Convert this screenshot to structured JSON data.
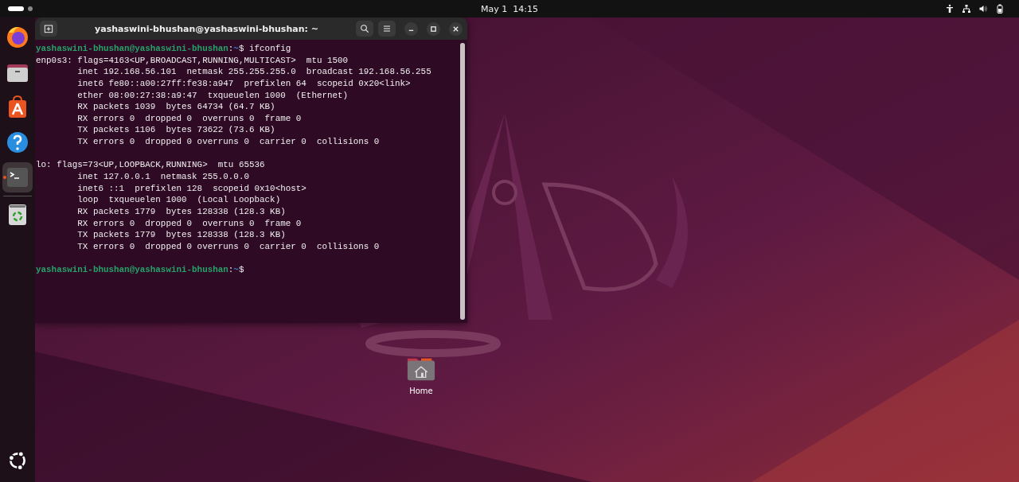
{
  "top_bar": {
    "workspaces": [
      {
        "selected": true
      },
      {
        "selected": false
      }
    ],
    "clock": "May 1  14:15",
    "status_icons": [
      {
        "kind": "accessibility"
      },
      {
        "kind": "network"
      },
      {
        "kind": "volume"
      },
      {
        "kind": "battery"
      }
    ]
  },
  "dock": {
    "items": [
      {
        "kind": "browser",
        "running": false,
        "selected": false
      },
      {
        "kind": "files",
        "running": false,
        "selected": false
      },
      {
        "kind": "store",
        "running": false,
        "selected": false
      },
      {
        "kind": "help",
        "running": false,
        "selected": false
      },
      {
        "kind": "terminal",
        "running": true,
        "selected": true
      },
      {
        "kind": "trash",
        "running": false,
        "selected": false
      }
    ],
    "apps_button": {
      "kind": "ubuntu"
    }
  },
  "terminal": {
    "title": "yashaswini-bhushan@yashaswini-bhushan: ~",
    "lines": [
      {
        "kind": "prompt",
        "user": "yashaswini-bhushan@yashaswini-bhushan",
        "sep": ":",
        "path": "~",
        "symbol": "$",
        "command": "ifconfig"
      },
      {
        "kind": "output",
        "text": "enp0s3: flags=4163<UP,BROADCAST,RUNNING,MULTICAST>  mtu 1500"
      },
      {
        "kind": "output",
        "text": "        inet 192.168.56.101  netmask 255.255.255.0  broadcast 192.168.56.255"
      },
      {
        "kind": "output",
        "text": "        inet6 fe80::a00:27ff:fe38:a947  prefixlen 64  scopeid 0x20<link>"
      },
      {
        "kind": "output",
        "text": "        ether 08:00:27:38:a9:47  txqueuelen 1000  (Ethernet)"
      },
      {
        "kind": "output",
        "text": "        RX packets 1039  bytes 64734 (64.7 KB)"
      },
      {
        "kind": "output",
        "text": "        RX errors 0  dropped 0  overruns 0  frame 0"
      },
      {
        "kind": "output",
        "text": "        TX packets 1106  bytes 73622 (73.6 KB)"
      },
      {
        "kind": "output",
        "text": "        TX errors 0  dropped 0 overruns 0  carrier 0  collisions 0"
      },
      {
        "kind": "blank"
      },
      {
        "kind": "output",
        "text": "lo: flags=73<UP,LOOPBACK,RUNNING>  mtu 65536"
      },
      {
        "kind": "output",
        "text": "        inet 127.0.0.1  netmask 255.0.0.0"
      },
      {
        "kind": "output",
        "text": "        inet6 ::1  prefixlen 128  scopeid 0x10<host>"
      },
      {
        "kind": "output",
        "text": "        loop  txqueuelen 1000  (Local Loopback)"
      },
      {
        "kind": "output",
        "text": "        RX packets 1779  bytes 128338 (128.3 KB)"
      },
      {
        "kind": "output",
        "text": "        RX errors 0  dropped 0  overruns 0  frame 0"
      },
      {
        "kind": "output",
        "text": "        TX packets 1779  bytes 128338 (128.3 KB)"
      },
      {
        "kind": "output",
        "text": "        TX errors 0  dropped 0 overruns 0  carrier 0  collisions 0"
      },
      {
        "kind": "blank"
      },
      {
        "kind": "prompt",
        "user": "yashaswini-bhushan@yashaswini-bhushan",
        "sep": ":",
        "path": "~",
        "symbol": "$"
      }
    ]
  },
  "desktop_icons": [
    {
      "kind": "home",
      "label": "Home"
    }
  ]
}
